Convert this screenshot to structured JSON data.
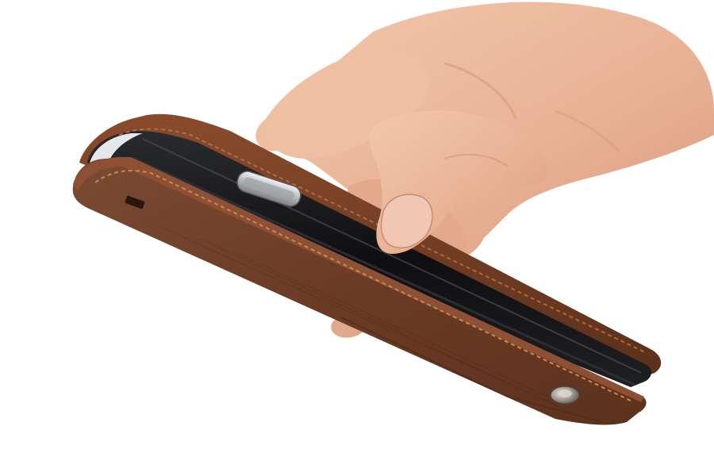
{
  "image": {
    "subject": "hand-holding-phone-wallet-case",
    "background": "#ffffff",
    "colors": {
      "leather": "#6a3b22",
      "leather_edge": "#8a4b2c",
      "stitching": "#c8894f",
      "phone_body": "#141416",
      "skin": "#e9b79a",
      "metal_button": "#c9cbcd",
      "snap_button": "#a7a4a0"
    }
  }
}
